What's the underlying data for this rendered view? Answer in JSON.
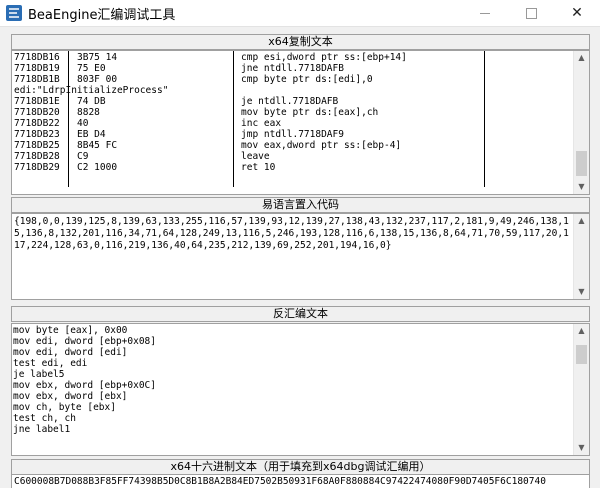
{
  "window": {
    "title": "BeaEngine汇编调试工具",
    "icon": "app-logo-icon",
    "minimize_label": "—",
    "maximize_label": "□",
    "close_label": "✕"
  },
  "sections": {
    "x64_copy": {
      "header": "x64复制文本"
    },
    "e_lang": {
      "header": "易语言置入代码"
    },
    "disasm": {
      "header": "反汇编文本"
    },
    "hex": {
      "header": "x64十六进制文本（用于填充到x64dbg调试汇编用）"
    }
  },
  "x64_rows": [
    {
      "addr": "7718DB16",
      "bytes": "3B75 14",
      "instr": "cmp esi,dword ptr ss:[ebp+14]"
    },
    {
      "addr": "7718DB19",
      "bytes": "75 E0",
      "instr": "jne ntdll.7718DAFB"
    },
    {
      "addr": "7718DB1B",
      "bytes": "803F 00",
      "instr": "cmp byte ptr ds:[edi],0"
    },
    {
      "addr": "edi:\"LdrpInitializeProcess\"",
      "bytes": "",
      "instr": ""
    },
    {
      "addr": "7718DB1E",
      "bytes": "74 DB",
      "instr": "je ntdll.7718DAFB"
    },
    {
      "addr": "7718DB20",
      "bytes": "8828",
      "instr": "mov byte ptr ds:[eax],ch"
    },
    {
      "addr": "7718DB22",
      "bytes": "40",
      "instr": "inc eax"
    },
    {
      "addr": "7718DB23",
      "bytes": "EB D4",
      "instr": "jmp ntdll.7718DAF9"
    },
    {
      "addr": "7718DB25",
      "bytes": "8B45 FC",
      "instr": "mov eax,dword ptr ss:[ebp-4]"
    },
    {
      "addr": "7718DB28",
      "bytes": "C9",
      "instr": "leave"
    },
    {
      "addr": "7718DB29",
      "bytes": "C2 1000",
      "instr": "ret 10"
    }
  ],
  "e_lang_code": "{198,0,0,139,125,8,139,63,133,255,116,57,139,93,12,139,27,138,43,132,237,117,2,181,9,49,246,138,15,136,8,132,201,116,34,71,64,128,249,13,116,5,246,193,128,116,6,138,15,136,8,64,71,70,59,117,20,117,224,128,63,0,116,219,136,40,64,235,212,139,69,252,201,194,16,0}",
  "disasm_lines": [
    "mov byte [eax], 0x00",
    "mov edi, dword [ebp+0x08]",
    "mov edi, dword [edi]",
    "test edi, edi",
    "je label5",
    "mov ebx, dword [ebp+0x0C]",
    "mov ebx, dword [ebx]",
    "mov ch, byte [ebx]",
    "test ch, ch",
    "jne label1"
  ],
  "hex_text": "C600008B7D088B3F85FF74398B5D0C8B1B8A2B84ED7502B50931F68A0F880884C97422474080F90D7405F6C180740"
}
